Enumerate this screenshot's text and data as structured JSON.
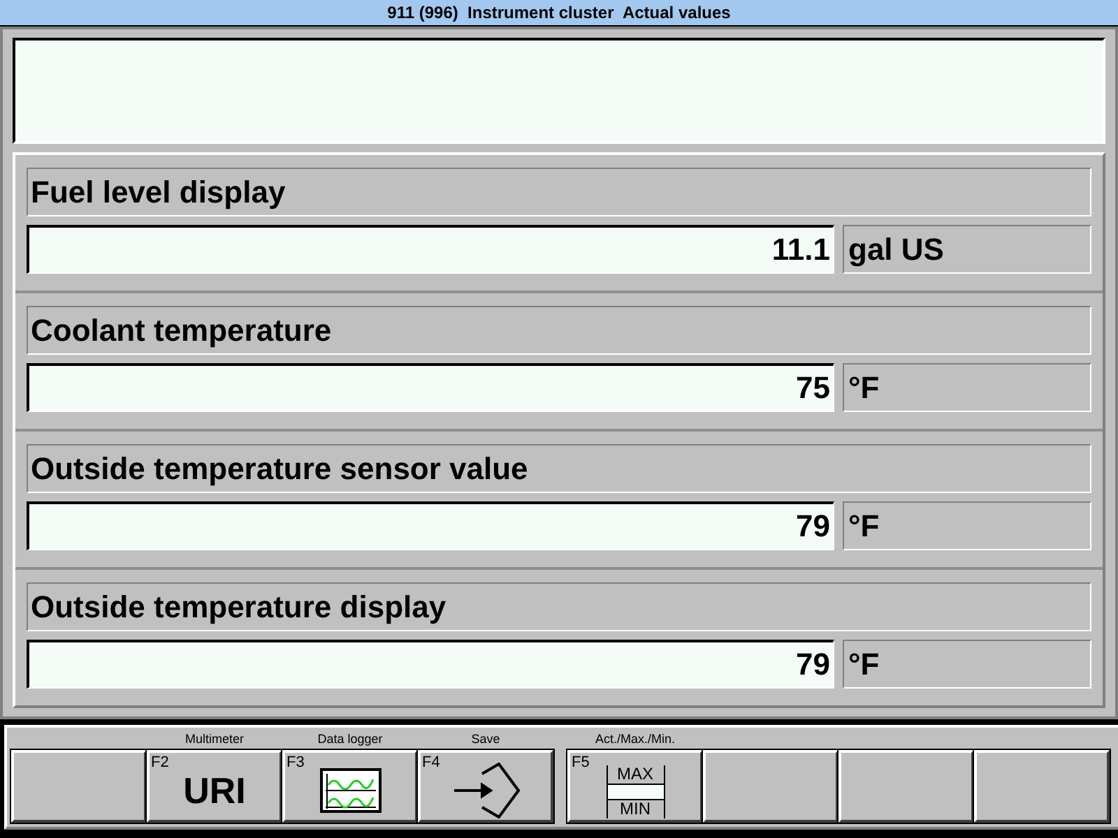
{
  "window": {
    "title": "911 (996)  Instrument cluster  Actual values"
  },
  "values": [
    {
      "label": "Fuel level display",
      "value": "11.1",
      "unit": "gal US"
    },
    {
      "label": "Coolant temperature",
      "value": "75",
      "unit": "°F"
    },
    {
      "label": "Outside temperature sensor value",
      "value": "79",
      "unit": "°F"
    },
    {
      "label": "Outside temperature display",
      "value": "79",
      "unit": "°F"
    }
  ],
  "function_keys": [
    {
      "kind": "empty"
    },
    {
      "kind": "text",
      "caption": "Multimeter",
      "key": "F2",
      "text": "URI"
    },
    {
      "kind": "chart",
      "caption": "Data logger",
      "key": "F3"
    },
    {
      "kind": "save",
      "caption": "Save",
      "key": "F4"
    },
    {
      "kind": "maxmin",
      "caption": "Act./Max./Min.",
      "key": "F5",
      "max": "MAX",
      "min": "MIN"
    },
    {
      "kind": "empty"
    },
    {
      "kind": "empty"
    },
    {
      "kind": "empty"
    }
  ]
}
